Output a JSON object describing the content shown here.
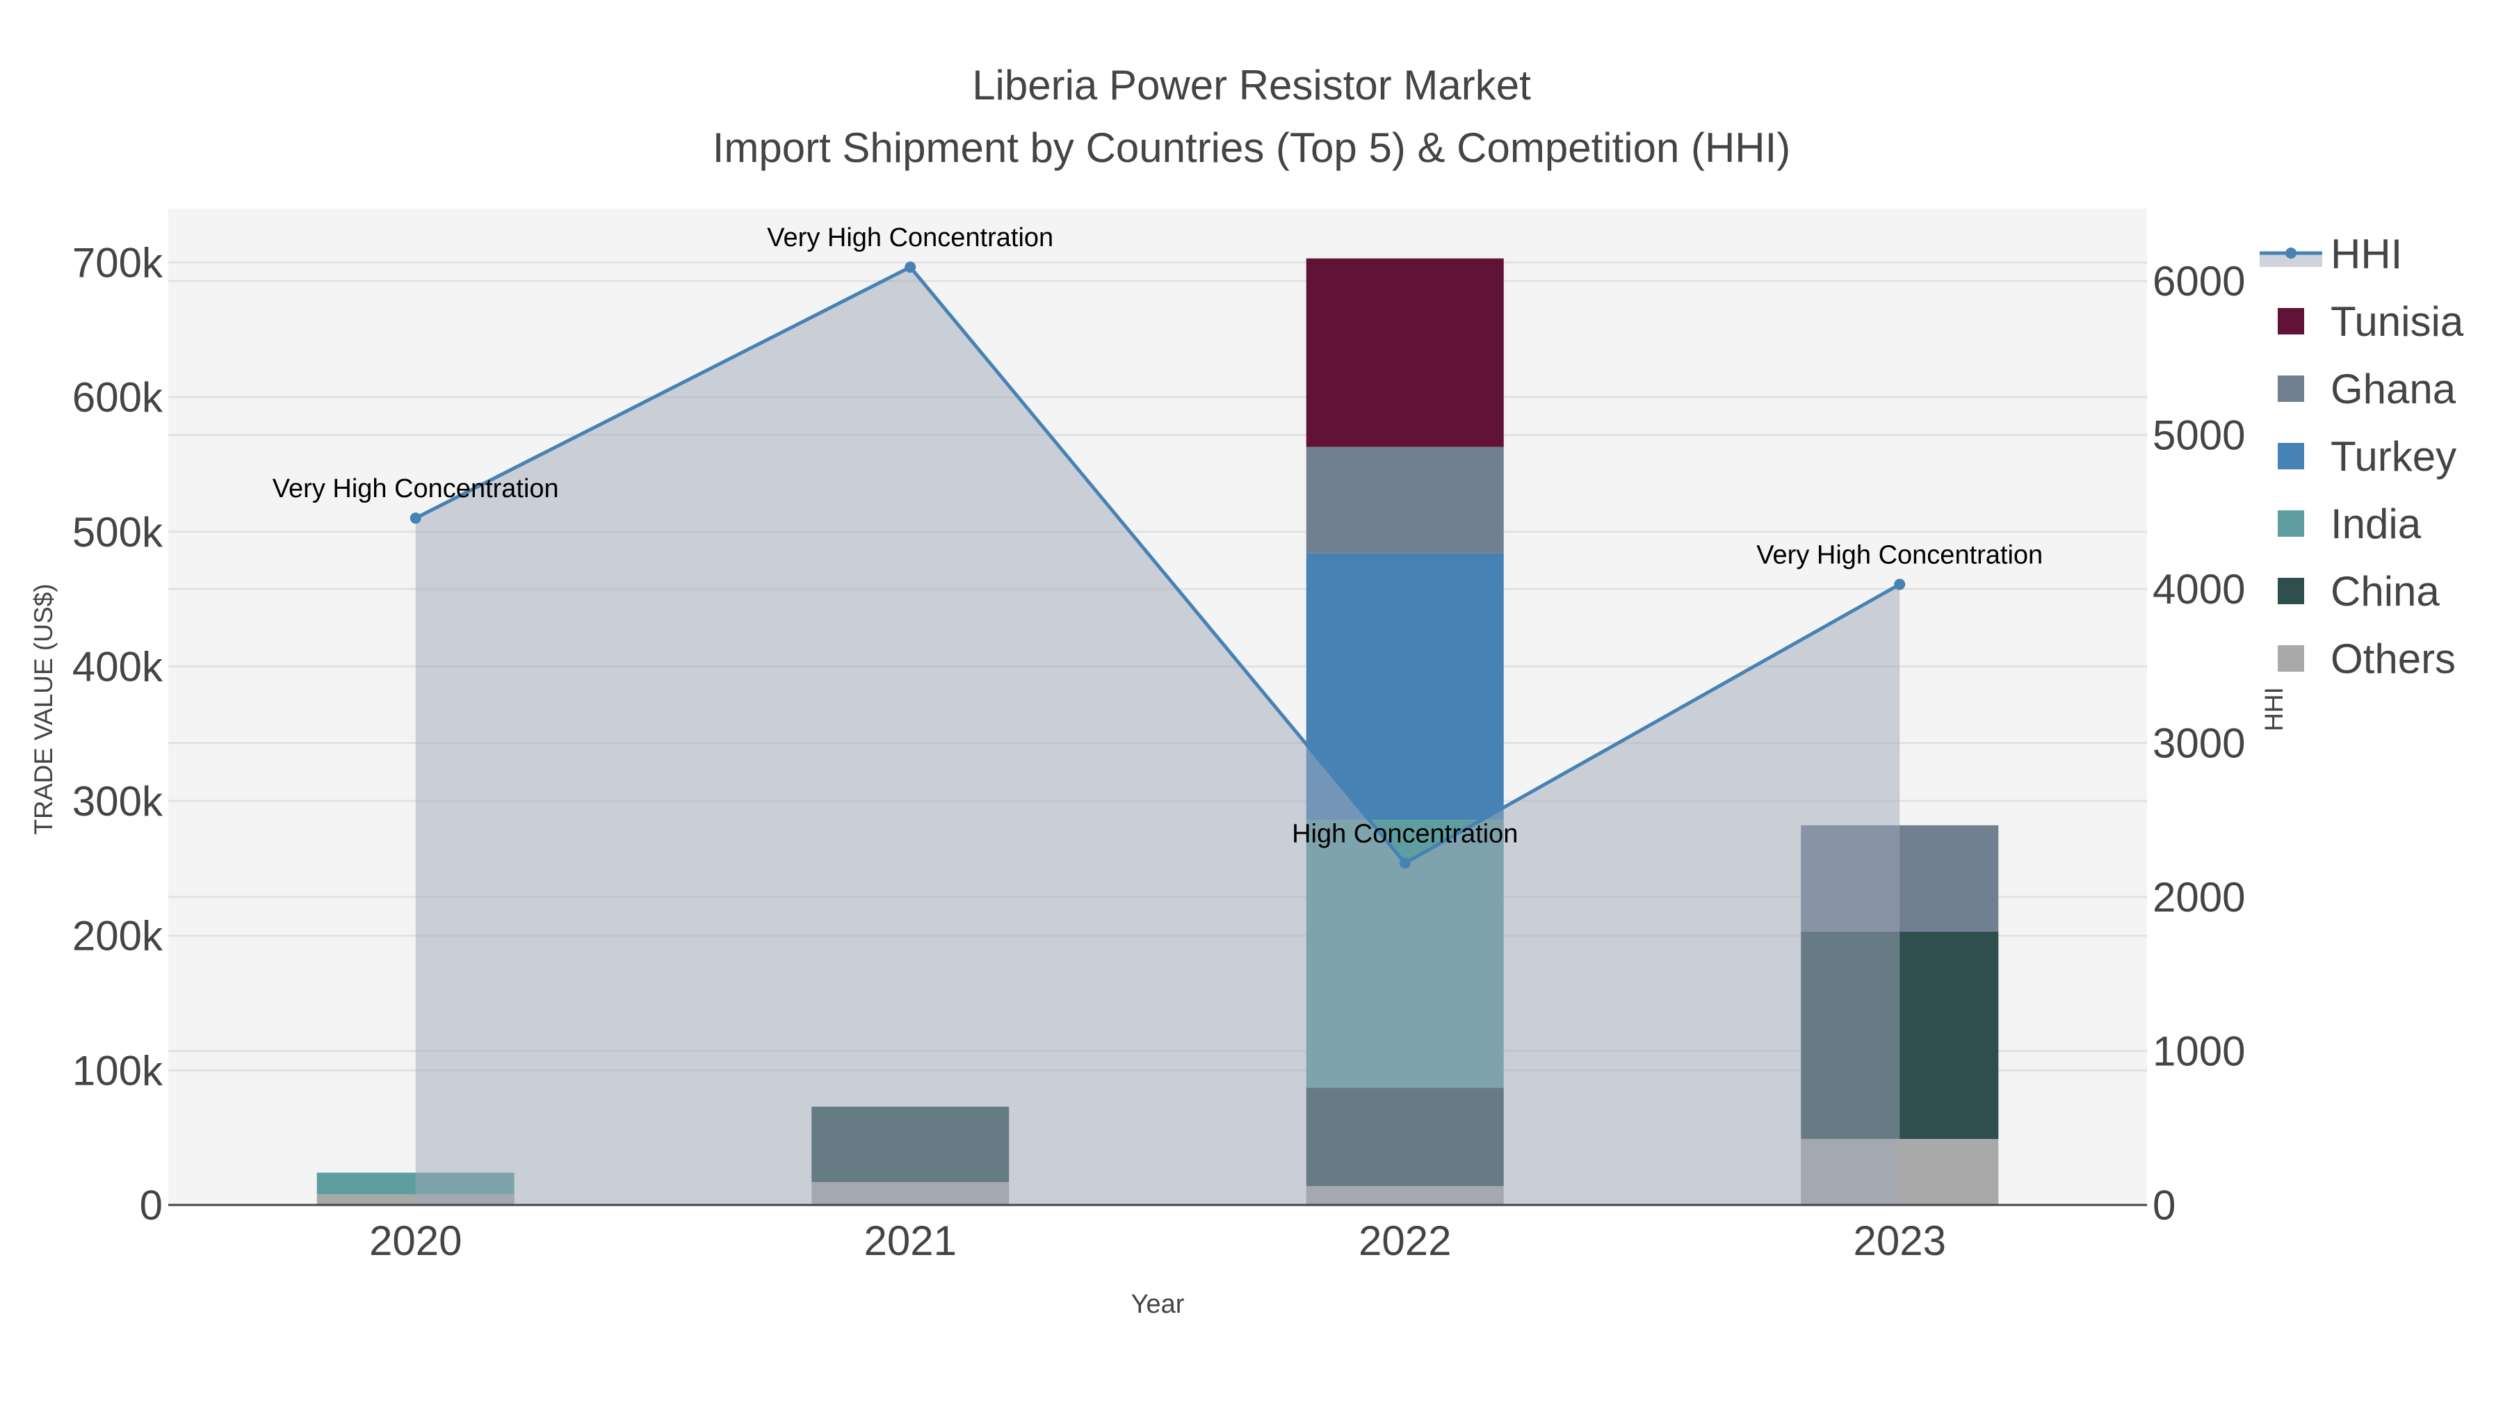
{
  "chart_data": {
    "type": "bar",
    "title": "Liberia Power Resistor Market",
    "subtitle": "Import Shipment by Countries (Top 5) & Competition (HHI)",
    "xlabel": "Year",
    "ylabel": "TRADE VALUE (US$)",
    "y2label": "HHI",
    "categories": [
      "2020",
      "2021",
      "2022",
      "2023"
    ],
    "ylim": [
      0,
      740000
    ],
    "y2lim": [
      0,
      6470
    ],
    "yticks": [
      0,
      100000,
      200000,
      300000,
      400000,
      500000,
      600000,
      700000
    ],
    "yticklabels": [
      "0",
      "100k",
      "200k",
      "300k",
      "400k",
      "500k",
      "600k",
      "700k"
    ],
    "y2ticks": [
      0,
      1000,
      2000,
      3000,
      4000,
      5000,
      6000
    ],
    "y2ticklabels": [
      "0",
      "1000",
      "2000",
      "3000",
      "4000",
      "5000",
      "6000"
    ],
    "series": [
      {
        "name": "Others",
        "color": "#a9a9a9",
        "values": [
          8000,
          17000,
          14000,
          49000
        ]
      },
      {
        "name": "China",
        "color": "#2f4f4f",
        "values": [
          0,
          56000,
          73000,
          154000
        ]
      },
      {
        "name": "India",
        "color": "#5f9ea0",
        "values": [
          16000,
          0,
          199000,
          0
        ]
      },
      {
        "name": "Turkey",
        "color": "#4682b4",
        "values": [
          0,
          0,
          198000,
          0
        ]
      },
      {
        "name": "Ghana",
        "color": "#708090",
        "values": [
          0,
          0,
          79000,
          79000
        ]
      },
      {
        "name": "Tunisia",
        "color": "#601336",
        "values": [
          0,
          0,
          140000,
          0
        ]
      }
    ],
    "hhi": {
      "name": "HHI",
      "color": "#4682b4",
      "values": [
        4460,
        6090,
        2220,
        4030
      ],
      "annotations": [
        "Very High Concentration",
        "Very High Concentration",
        "High Concentration",
        "Very High Concentration"
      ]
    },
    "legend": [
      "HHI",
      "Tunisia",
      "Ghana",
      "Turkey",
      "India",
      "China",
      "Others"
    ],
    "legend_position": "right",
    "grid": true
  }
}
